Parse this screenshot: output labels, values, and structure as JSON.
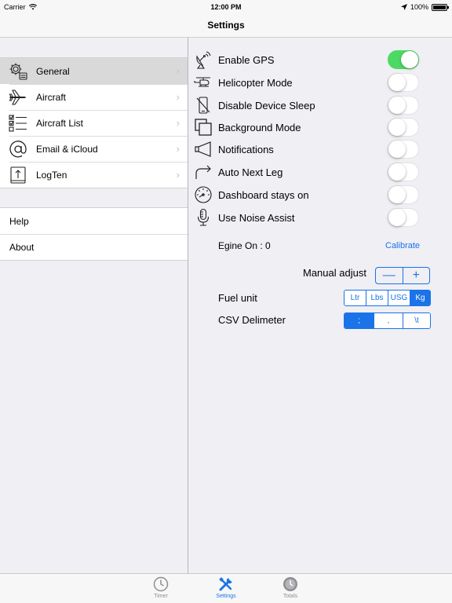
{
  "status_bar": {
    "carrier": "Carrier",
    "time": "12:00 PM",
    "battery": "100%"
  },
  "nav": {
    "title": "Settings"
  },
  "master": {
    "items": [
      {
        "label": "General",
        "icon": "gear-icon",
        "selected": true
      },
      {
        "label": "Aircraft",
        "icon": "airplane-icon"
      },
      {
        "label": "Aircraft List",
        "icon": "checklist-icon"
      },
      {
        "label": "Email & iCloud",
        "icon": "at-sign-icon"
      },
      {
        "label": "LogTen",
        "icon": "export-icon"
      }
    ],
    "extra_items": [
      {
        "label": "Help"
      },
      {
        "label": "About"
      }
    ],
    "chevron": "›"
  },
  "detail": {
    "settings": [
      {
        "label": "Enable GPS",
        "icon": "satellite-dish-icon",
        "on": true
      },
      {
        "label": "Helicopter Mode",
        "icon": "helicopter-icon",
        "on": false
      },
      {
        "label": "Disable Device Sleep",
        "icon": "no-phone-icon",
        "on": false
      },
      {
        "label": "Background Mode",
        "icon": "windows-icon",
        "on": false
      },
      {
        "label": "Notifications",
        "icon": "megaphone-icon",
        "on": false
      },
      {
        "label": "Auto Next Leg",
        "icon": "redirect-arrow-icon",
        "on": false
      },
      {
        "label": "Dashboard stays on",
        "icon": "gauge-icon",
        "on": false
      },
      {
        "label": "Use Noise Assist",
        "icon": "microphone-icon",
        "on": false
      }
    ],
    "engine_on": "Egine On : 0",
    "calibrate": "Calibrate",
    "manual_adjust": {
      "label": "Manual adjust",
      "minus": "—",
      "plus": "+"
    },
    "fuel_unit": {
      "label": "Fuel unit",
      "options": [
        "Ltr",
        "Lbs",
        "USG",
        "Kg"
      ],
      "selected": "Kg"
    },
    "csv_delimeter": {
      "label": "CSV Delimeter",
      "options": [
        ";",
        ",",
        "\\t"
      ],
      "selected": ";"
    }
  },
  "tabs": [
    {
      "label": "Timer",
      "icon": "clock-icon",
      "active": false
    },
    {
      "label": "Settings",
      "icon": "tools-icon",
      "active": true
    },
    {
      "label": "Totals",
      "icon": "totals-clock-icon",
      "active": false
    }
  ],
  "colors": {
    "accent": "#1a73e8",
    "toggle_on": "#4cd964",
    "selected_row": "#d9d9d9"
  }
}
